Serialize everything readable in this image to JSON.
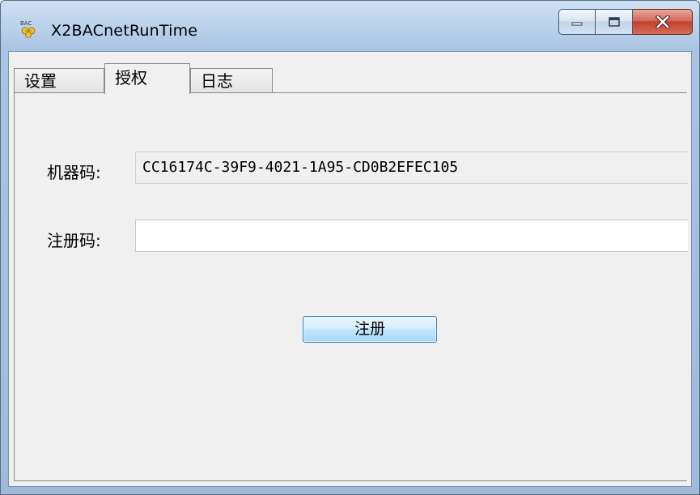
{
  "window": {
    "title": "X2BACnetRunTime",
    "icon_name": "bacnet-app-icon",
    "icon_text": "BAC"
  },
  "caption": {
    "minimize": "minimize-icon",
    "maximize": "maximize-icon",
    "close": "close-icon"
  },
  "tabs": [
    {
      "label": "设置",
      "active": false
    },
    {
      "label": "授权",
      "active": true
    },
    {
      "label": "日志",
      "active": false
    }
  ],
  "form": {
    "machine_code_label": "机器码:",
    "machine_code_value": "CC16174C-39F9-4021-1A95-CD0B2EFEC105",
    "reg_code_label": "注册码:",
    "reg_code_value": "",
    "register_button": "注册"
  },
  "colors": {
    "titlebar": "#bcd3ec",
    "close_button": "#c3402f",
    "button_border": "#3c7fb1"
  }
}
